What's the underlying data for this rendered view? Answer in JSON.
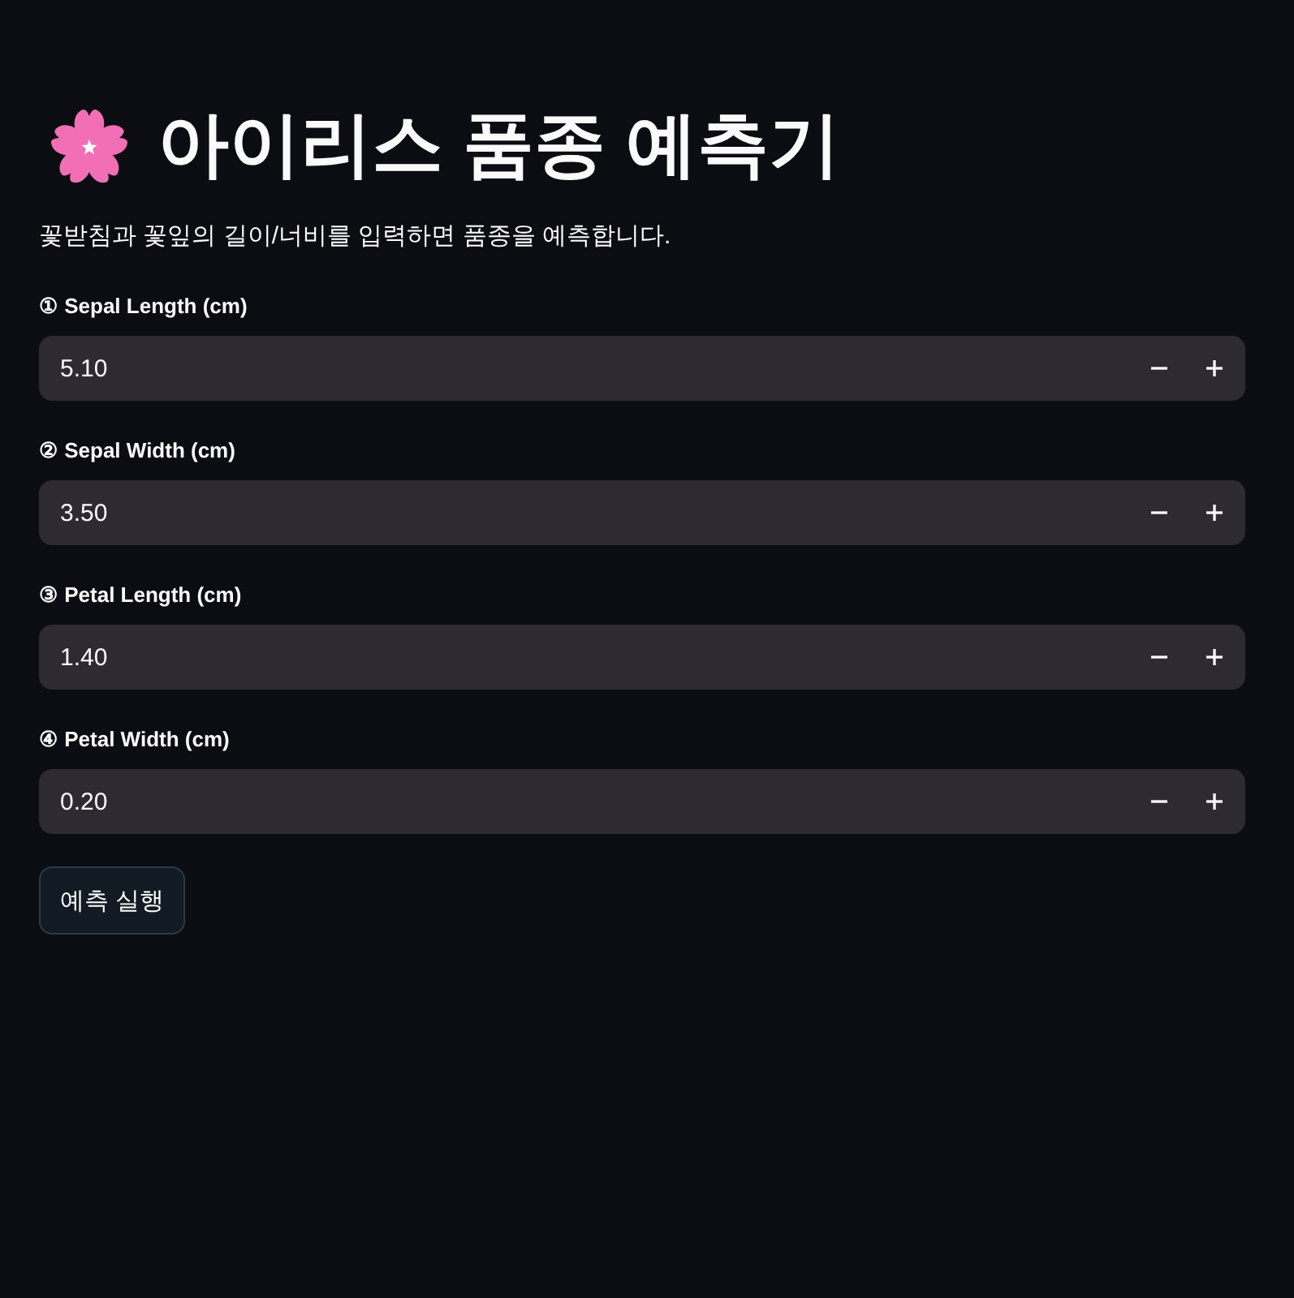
{
  "title": "아이리스 품종 예측기",
  "description": "꽃받침과 꽃잎의 길이/너비를 입력하면 품종을 예측합니다.",
  "fields": [
    {
      "label": "① Sepal Length (cm)",
      "value": "5.10"
    },
    {
      "label": "② Sepal Width (cm)",
      "value": "3.50"
    },
    {
      "label": "③ Petal Length (cm)",
      "value": "1.40"
    },
    {
      "label": "④ Petal Width (cm)",
      "value": "0.20"
    }
  ],
  "button": {
    "label": "예측 실행"
  }
}
